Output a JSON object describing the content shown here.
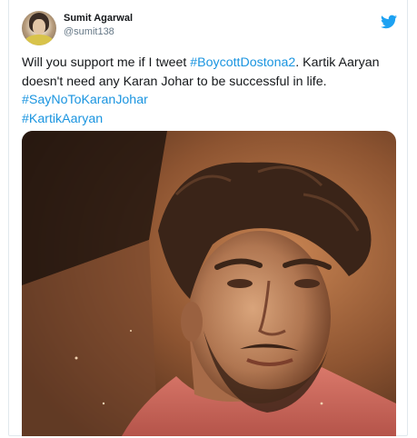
{
  "tweet": {
    "author_name": "Sumit Agarwal",
    "author_handle": "@sumit138",
    "text_part_1": "Will you support me if I tweet ",
    "hashtag_1": "#BoycottDostona2",
    "text_part_2": ". Kartik Aaryan doesn't need any Karan Johar to be successful in life.",
    "hashtag_2": "#SayNoToKaranJohar",
    "hashtag_3": "#KartikAaryan"
  },
  "icons": {
    "brand": "twitter-bird-icon",
    "brand_color": "#1da1f2",
    "hashtag_color": "#1b95e0"
  }
}
